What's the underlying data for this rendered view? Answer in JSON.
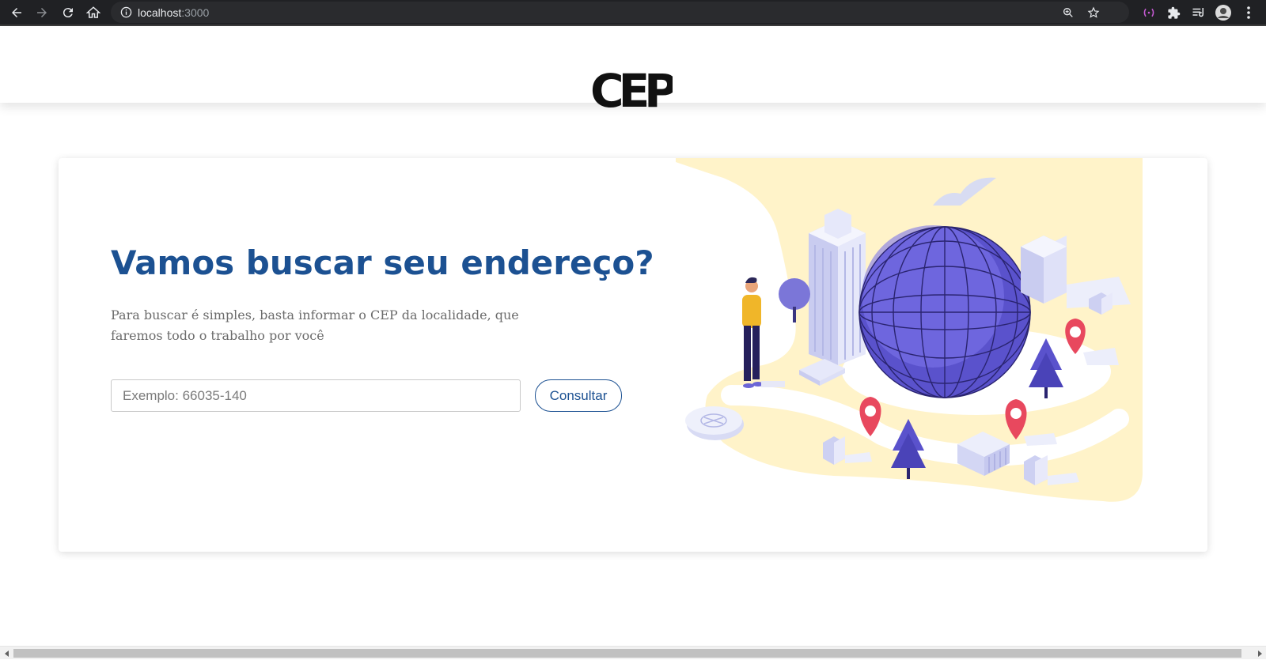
{
  "browser": {
    "url_host": "localhost",
    "url_port": ":3000"
  },
  "header": {
    "logo_text": "CEP"
  },
  "hero": {
    "title": "Vamos buscar seu endereço?",
    "description": "Para buscar é simples, basta informar o CEP da localidade, que faremos todo o trabalho por você"
  },
  "search": {
    "placeholder": "Exemplo: 66035-140",
    "value": "",
    "button_label": "Consultar"
  },
  "colors": {
    "accent": "#1c5192",
    "globe": "#5a52cc",
    "map_background": "#fff3c9",
    "pin": "#e8485e"
  },
  "icons": [
    "back-icon",
    "forward-icon",
    "reload-icon",
    "home-icon",
    "info-icon",
    "zoom-icon",
    "star-icon",
    "extension-icon",
    "puzzle-icon",
    "reading-list-icon",
    "profile-icon",
    "menu-icon"
  ]
}
